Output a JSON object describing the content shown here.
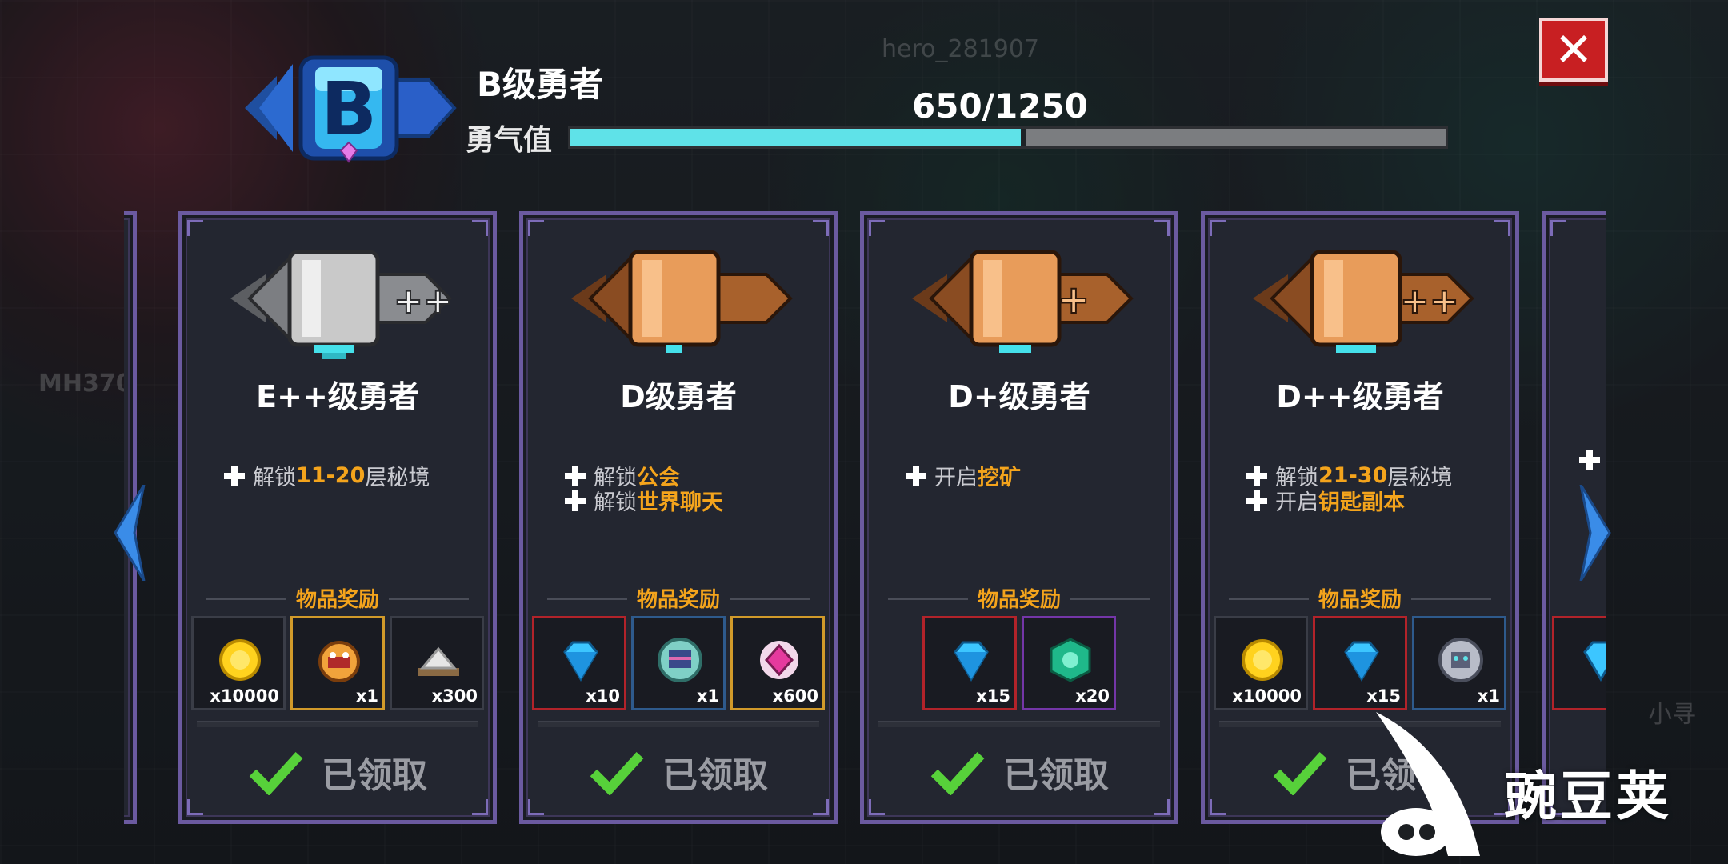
{
  "background": {
    "player_name_top": "hero_281907",
    "player_name_left": "MH370",
    "player_name_right": "小寻"
  },
  "header": {
    "rank_letter": "B",
    "rank_title": "B级勇者",
    "courage_label": "勇气值",
    "progress_text": "650/1250",
    "progress_fraction": 0.52
  },
  "colors": {
    "panel_border": "#6b5aa0",
    "highlight": "#f4a41c",
    "progress_fill": "#5fe2e8",
    "close_button": "#c81f22"
  },
  "cards": [
    {
      "title": "E++级勇者",
      "badge": "E++ rank badge (grey)",
      "unlocks": [
        {
          "pre": "解锁",
          "hl": "11-20",
          "post": "层秘境"
        }
      ],
      "rewards_label": "物品奖励",
      "items": [
        {
          "icon": "gold-coin-icon",
          "qty": "x10000"
        },
        {
          "icon": "treasure-pot-icon",
          "qty": "x1"
        },
        {
          "icon": "ore-pile-icon",
          "qty": "x300"
        }
      ],
      "claim_label": "已领取"
    },
    {
      "title": "D级勇者",
      "badge": "D rank badge (bronze)",
      "unlocks": [
        {
          "pre": "解锁 ",
          "hl": "公会",
          "post": ""
        },
        {
          "pre": "解锁",
          "hl": "世界聊天",
          "post": ""
        }
      ],
      "rewards_label": "物品奖励",
      "items": [
        {
          "icon": "blue-diamond-icon",
          "qty": "x10"
        },
        {
          "icon": "chest-medallion-icon",
          "qty": "x1"
        },
        {
          "icon": "pink-gem-icon",
          "qty": "x600"
        }
      ],
      "claim_label": "已领取"
    },
    {
      "title": "D+级勇者",
      "badge": "D+ rank badge (bronze)",
      "unlocks": [
        {
          "pre": "开启",
          "hl": "挖矿",
          "post": ""
        }
      ],
      "rewards_label": "物品奖励",
      "items": [
        {
          "icon": "blue-diamond-icon",
          "qty": "x15"
        },
        {
          "icon": "green-token-icon",
          "qty": "x20"
        }
      ],
      "claim_label": "已领取"
    },
    {
      "title": "D++级勇者",
      "badge": "D++ rank badge (bronze)",
      "unlocks": [
        {
          "pre": "解锁",
          "hl": "21-30",
          "post": "层秘境"
        },
        {
          "pre": "开启",
          "hl": "钥匙副本",
          "post": ""
        }
      ],
      "rewards_label": "物品奖励",
      "items": [
        {
          "icon": "gold-coin-icon",
          "qty": "x10000"
        },
        {
          "icon": "blue-diamond-icon",
          "qty": "x15"
        },
        {
          "icon": "robot-medallion-icon",
          "qty": "x1"
        }
      ],
      "claim_label": "已领"
    }
  ],
  "watermark": {
    "text": "豌豆荚"
  }
}
